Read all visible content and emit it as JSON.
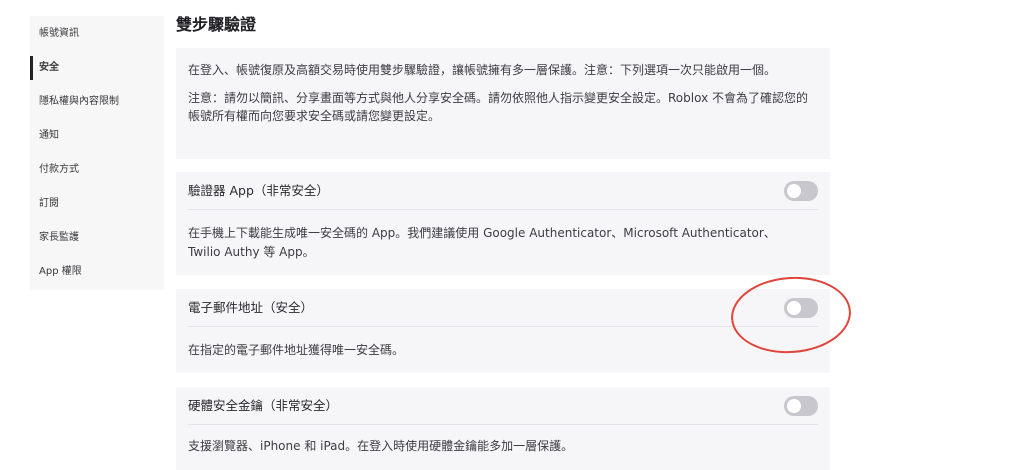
{
  "sidebar": {
    "items": [
      {
        "label": "帳號資訊",
        "active": false
      },
      {
        "label": "安全",
        "active": true
      },
      {
        "label": "隱私權與內容限制",
        "active": false
      },
      {
        "label": "通知",
        "active": false
      },
      {
        "label": "付款方式",
        "active": false
      },
      {
        "label": "訂閱",
        "active": false
      },
      {
        "label": "家長監護",
        "active": false
      },
      {
        "label": "App 權限",
        "active": false
      }
    ]
  },
  "main": {
    "title": "雙步驟驗證",
    "intro": {
      "p1": "在登入、帳號復原及高額交易時使用雙步驟驗證，讓帳號擁有多一層保護。注意：下列選項一次只能啟用一個。",
      "p2": "注意：請勿以簡訊、分享畫面等方式與他人分享安全碼。請勿依照他人指示變更安全設定。Roblox 不會為了確認您的帳號所有權而向您要求安全碼或請您變更設定。"
    },
    "options": [
      {
        "label": "驗證器 App（非常安全）",
        "description": "在手機上下載能生成唯一安全碼的 App。我們建議使用 Google Authenticator、Microsoft Authenticator、Twilio Authy 等 App。",
        "enabled": false
      },
      {
        "label": "電子郵件地址（安全）",
        "description": "在指定的電子郵件地址獲得唯一安全碼。",
        "enabled": false
      },
      {
        "label": "硬體安全金鑰（非常安全）",
        "description": "支援瀏覽器、iPhone 和 iPad。在登入時使用硬體金鑰能多加一層保護。",
        "enabled": false
      }
    ]
  },
  "colors": {
    "annotation_ring": "#e0443a",
    "toggle_off": "#c8c7cd",
    "card_bg": "#f6f5f7"
  }
}
